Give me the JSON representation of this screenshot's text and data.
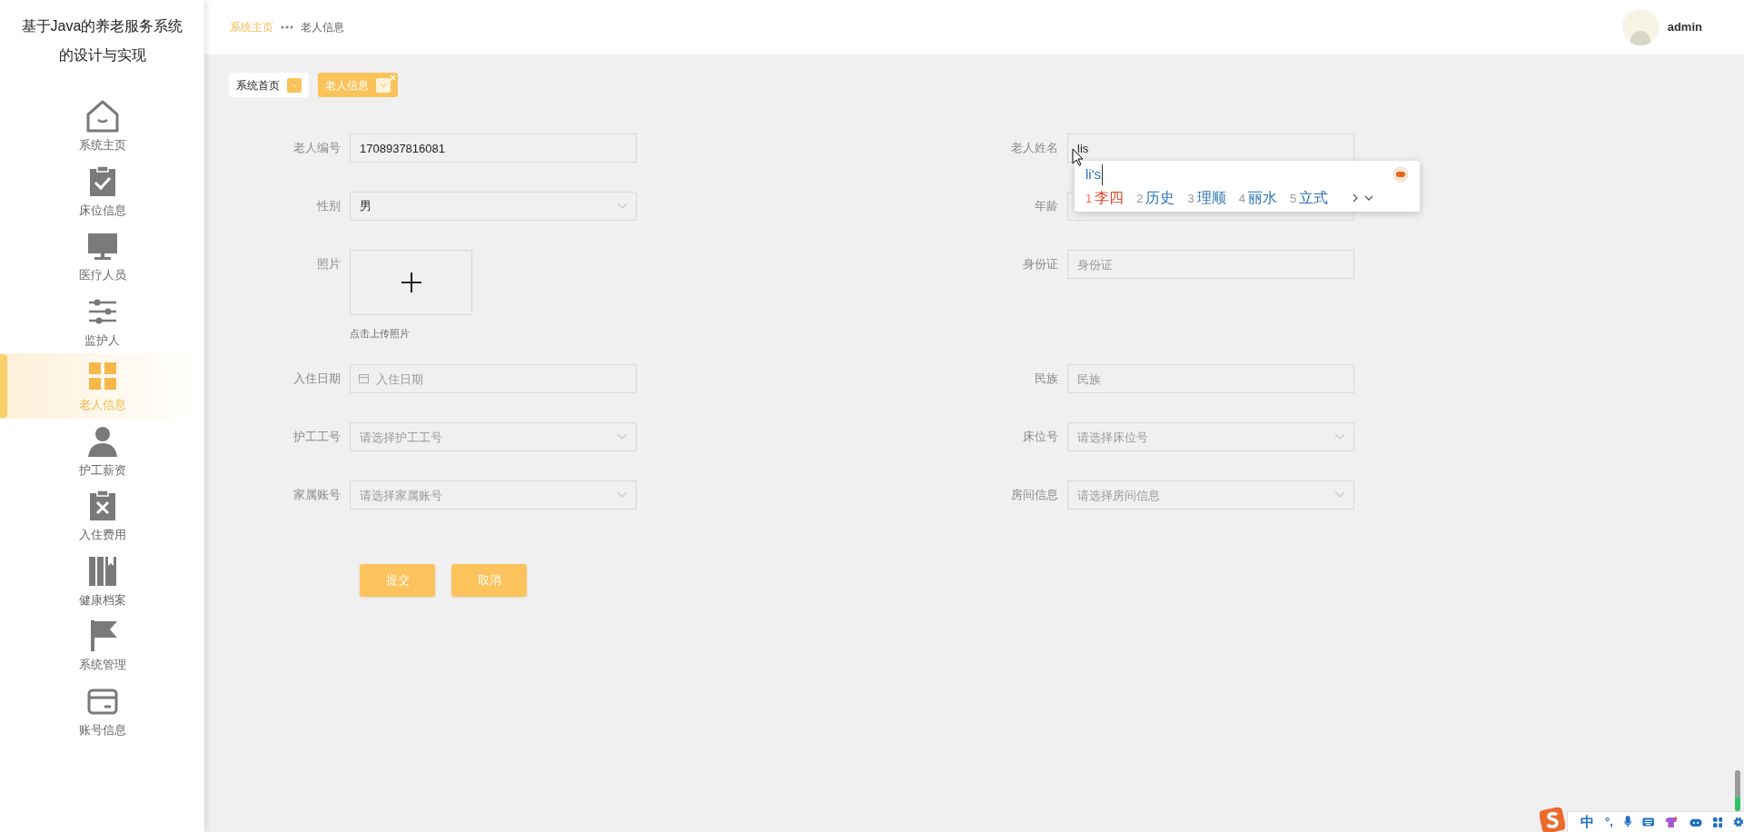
{
  "app_title": "基于Java的养老服务系统的设计与实现",
  "sidebar": {
    "items": [
      {
        "label": "系统主页",
        "selected": false
      },
      {
        "label": "床位信息",
        "selected": false
      },
      {
        "label": "医疗人员",
        "selected": false
      },
      {
        "label": "监护人",
        "selected": false
      },
      {
        "label": "老人信息",
        "selected": true
      },
      {
        "label": "护工薪资",
        "selected": false
      },
      {
        "label": "入住费用",
        "selected": false
      },
      {
        "label": "健康档案",
        "selected": false
      },
      {
        "label": "系统管理",
        "selected": false
      },
      {
        "label": "账号信息",
        "selected": false
      }
    ]
  },
  "breadcrumb": [
    "系统主页",
    "老人信息"
  ],
  "user": {
    "name": "admin"
  },
  "tabs": [
    {
      "label": "系统首页",
      "selected": false
    },
    {
      "label": "老人信息",
      "selected": true
    }
  ],
  "form": {
    "rows": [
      {
        "left": {
          "label": "老人编号",
          "kind": "input",
          "value": "1708937816081"
        },
        "right": {
          "label": "老人姓名",
          "kind": "input",
          "value": "lis"
        }
      },
      {
        "left": {
          "label": "性别",
          "kind": "select",
          "value": "男"
        },
        "right": {
          "label": "年龄",
          "kind": "input"
        }
      },
      {
        "left": {
          "label": "照片",
          "kind": "upload",
          "hint": "点击上传照片"
        },
        "right": {
          "label": "身份证",
          "kind": "input",
          "placeholder": "身份证"
        }
      },
      {
        "left": {
          "label": "入住日期",
          "kind": "date",
          "placeholder": "入住日期"
        },
        "right": {
          "label": "民族",
          "kind": "input",
          "placeholder": "民族"
        }
      },
      {
        "left": {
          "label": "护工工号",
          "kind": "select",
          "placeholder": "请选择护工工号"
        },
        "right": {
          "label": "床位号",
          "kind": "select",
          "placeholder": "请选择床位号"
        }
      },
      {
        "left": {
          "label": "家属账号",
          "kind": "select",
          "placeholder": "请选择家属账号"
        },
        "right": {
          "label": "房间信息",
          "kind": "select",
          "placeholder": "请选择房间信息"
        }
      }
    ],
    "buttons": [
      "提交",
      "取消"
    ]
  },
  "ime_popup": {
    "composition": "li's",
    "candidates": [
      {
        "index": "1",
        "text": "李四",
        "selected": true
      },
      {
        "index": "2",
        "text": "历史",
        "selected": false
      },
      {
        "index": "3",
        "text": "理顺",
        "selected": false
      },
      {
        "index": "4",
        "text": "丽水",
        "selected": false
      },
      {
        "index": "5",
        "text": "立式",
        "selected": false
      }
    ]
  },
  "ime_toolbar": {
    "mode": "中",
    "punctuation": "°,"
  }
}
